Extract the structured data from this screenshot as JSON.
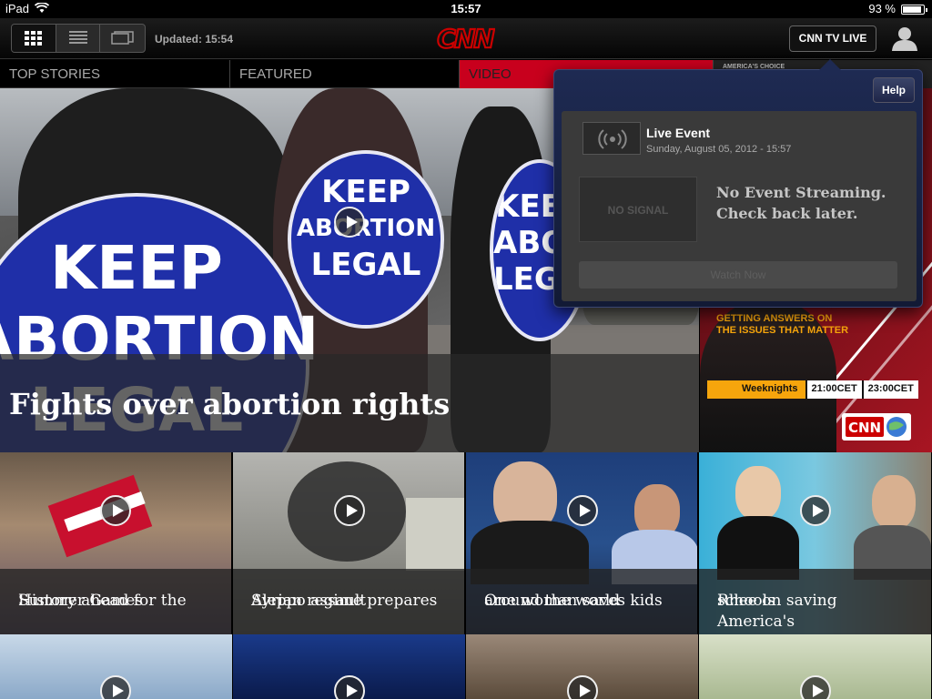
{
  "status_bar": {
    "device": "iPad",
    "time": "15:57",
    "battery_text": "93 %",
    "battery_level": 0.93
  },
  "toolbar": {
    "updated": "Updated: 15:54",
    "logo_text": "CNN",
    "live_button": "CNN TV LIVE",
    "view_modes": [
      "grid",
      "list",
      "slides"
    ],
    "active_view": "grid"
  },
  "tabs": [
    {
      "label": "TOP STORIES",
      "active": false
    },
    {
      "label": "FEATURED",
      "active": false
    },
    {
      "label": "VIDEO",
      "active": true
    }
  ],
  "tab_promo": "AMERICA'S CHOICE",
  "hero": {
    "title": "Fights over abortion rights",
    "sign_lines": [
      "KEEP",
      "ABORTION",
      "LEGAL"
    ]
  },
  "promo": {
    "headline_line1": "GETTING ANSWERS ON",
    "headline_line2": "THE ISSUES THAT MATTER",
    "schedule_label": "Weeknights",
    "time1": "21:00CET",
    "time2": "23:00CET",
    "badge": "CNN"
  },
  "popover": {
    "help": "Help",
    "live_event_title": "Live Event",
    "live_event_date": "Sunday, August 05, 2012 - 15:57",
    "no_signal": "NO SIGNAL",
    "message_line1": "No Event Streaming.",
    "message_line2": "Check back later.",
    "watch_button": "Watch Now"
  },
  "tiles": [
    {
      "caption_line1": "History ahead for the",
      "caption_line2": "Summer Games"
    },
    {
      "caption_line1": "Syrian regime prepares",
      "caption_line2": "Aleppo assault"
    },
    {
      "caption_line1": "One woman saves kids",
      "caption_line2": "around the world"
    },
    {
      "caption_line1": "Rhee on saving America's",
      "caption_line2": "schools"
    }
  ],
  "colors": {
    "cnn_red": "#cc0000",
    "active_tab": "#c8001d",
    "promo_orange": "#f6a50c",
    "popover_blue": "#1e2a52"
  }
}
